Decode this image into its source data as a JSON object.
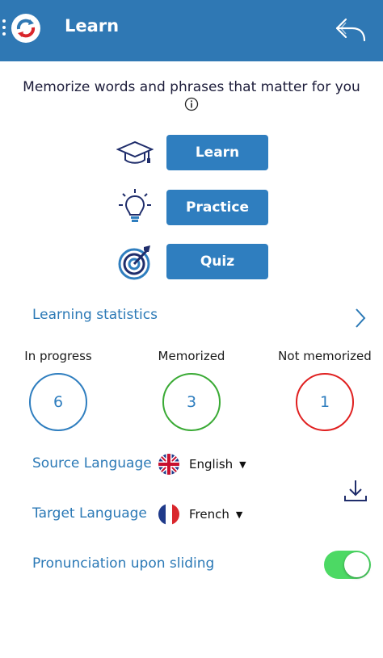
{
  "header": {
    "title": "Learn"
  },
  "tagline": "Memorize words and phrases that matter for you",
  "actions": [
    {
      "label": "Learn",
      "icon": "graduation-cap-icon"
    },
    {
      "label": "Practice",
      "icon": "lightbulb-icon"
    },
    {
      "label": "Quiz",
      "icon": "target-icon"
    }
  ],
  "statistics": {
    "title": "Learning statistics",
    "items": [
      {
        "label": "In progress",
        "value": "6",
        "color": "#2f7ebf"
      },
      {
        "label": "Memorized",
        "value": "3",
        "color": "#3aaa35"
      },
      {
        "label": "Not memorized",
        "value": "1",
        "color": "#e02020"
      }
    ]
  },
  "languages": {
    "source_label": "Source Language",
    "source_value": "English",
    "target_label": "Target Language",
    "target_value": "French"
  },
  "pronunciation": {
    "label": "Pronunciation upon sliding",
    "enabled": true
  },
  "colors": {
    "header": "#2f78b4",
    "accent": "#2f7ebf",
    "toggle_on": "#4cd964"
  }
}
